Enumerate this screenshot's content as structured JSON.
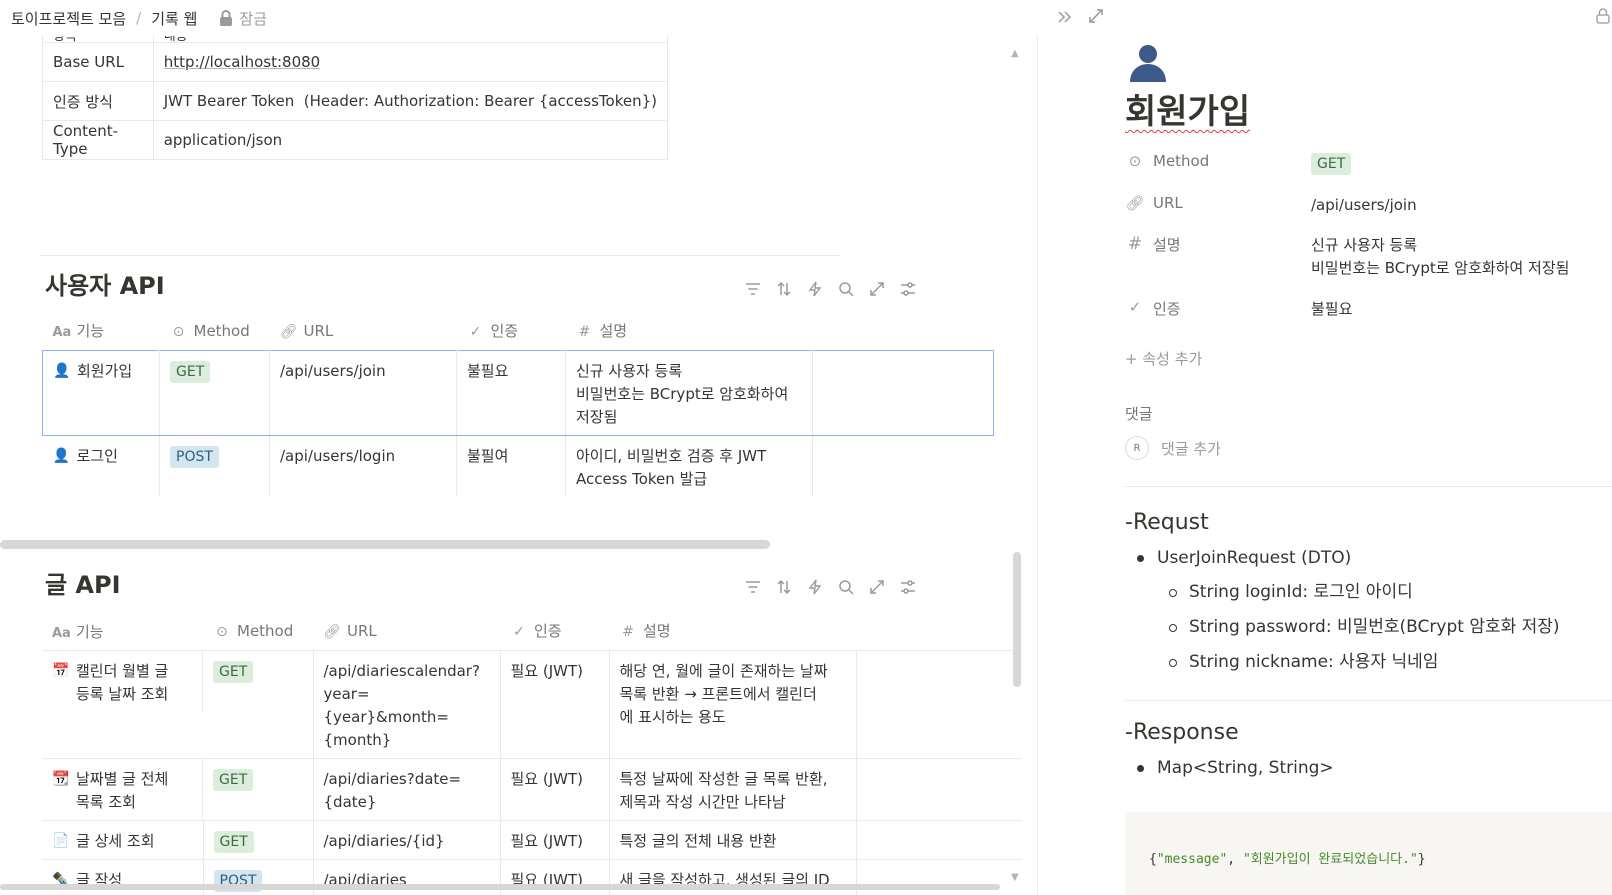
{
  "breadcrumb": {
    "parent": "토이프로젝트 모음",
    "current": "기록 웹",
    "lock": "잠금"
  },
  "info_table": {
    "clipped_row": [
      "항목",
      "내용"
    ],
    "rows": [
      {
        "key": "Base URL",
        "value": "http://localhost:8080",
        "link": true
      },
      {
        "key": "인증 방식",
        "value": "JWT Bearer Token  (Header: Authorization: Bearer {accessToken})"
      },
      {
        "key": "Content-Type",
        "value": "application/json"
      }
    ]
  },
  "headers": {
    "name": "기능",
    "method": "Method",
    "url": "URL",
    "auth": "인증",
    "desc": "설명"
  },
  "user_api": {
    "title": "사용자 API",
    "rows": [
      {
        "icon": "👤",
        "name": "회원가입",
        "method": "GET",
        "url": "/api/users/join",
        "auth": "불필요",
        "desc": "신규 사용자 등록\n비밀번호는 BCrypt로 암호화하여\n저장됨"
      },
      {
        "icon": "👤",
        "name": "로그인",
        "method": "POST",
        "url": "/api/users/login",
        "auth": "불필여",
        "desc": "아이디, 비밀번호 검증 후 JWT\nAccess Token 발급"
      }
    ]
  },
  "post_api": {
    "title": "글 API",
    "rows": [
      {
        "icon": "📅",
        "name": "캘린더 월별 글\n등록 날짜 조회",
        "method": "GET",
        "url": "/api/diariescalendar?\nyear={year}&month=\n{month}",
        "auth": "필요 (JWT)",
        "desc": "해당 연, 월에 글이 존재하는 날짜\n목록 반환 → 프론트에서 캘린더\n에 표시하는 용도"
      },
      {
        "icon": "📆",
        "name": "날짜별 글 전체\n목록 조회",
        "method": "GET",
        "url": "/api/diaries?date={date}",
        "auth": "필요 (JWT)",
        "desc": "특정 날짜에 작성한 글 목록 반환,\n제목과 작성 시간만 나타남"
      },
      {
        "icon": "📄",
        "name": "글 상세 조회",
        "method": "GET",
        "url": "/api/diaries/{id}",
        "auth": "필요 (JWT)",
        "desc": "특정 글의 전체 내용 반환"
      },
      {
        "icon": "✒️",
        "name": "글 작성",
        "method": "POST",
        "url": "/api/diaries",
        "auth": "필요 (JWT)",
        "desc": "새 글을 작성하고, 생성된 글의 ID"
      }
    ]
  },
  "detail": {
    "title": "회원가입",
    "props": [
      {
        "icon": "method-icon",
        "label": "Method",
        "value": "GET"
      },
      {
        "icon": "link-icon",
        "label": "URL",
        "value": "/api/users/join"
      },
      {
        "icon": "hash-icon",
        "label": "설명",
        "value": "신규 사용자 등록\n비밀번호는 BCrypt로 암호화하여 저장됨"
      },
      {
        "icon": "check-icon",
        "label": "인증",
        "value": "불필요"
      }
    ],
    "add_property": "+  속성 추가",
    "comments_label": "댓글",
    "comment_avatar": "R",
    "add_comment": "댓글 추가",
    "request_heading": "-Requst",
    "request_dto": "UserJoinRequest (DTO)",
    "request_fields": [
      "String loginId: 로그인 아이디",
      "String password: 비밀번호(BCrypt 암호화 저장)",
      "String nickname: 사용자 닉네임"
    ],
    "response_heading": "-Response",
    "response_type": "Map<String, String>",
    "code": {
      "open": "{",
      "key": "\"message\"",
      "sep": ", ",
      "value": "\"회원가입이 완료되었습니다.\"",
      "close": "}"
    }
  }
}
